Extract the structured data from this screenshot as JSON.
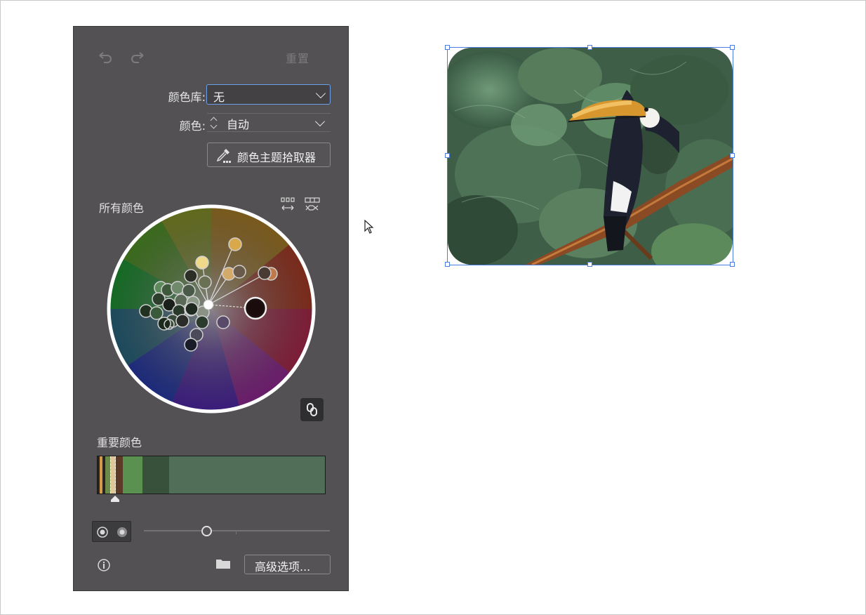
{
  "panel": {
    "undo_icon": "undo-icon",
    "redo_icon": "redo-icon",
    "reset_label": "重置",
    "library_label": "颜色库:",
    "library_value": "无",
    "color_label": "颜色:",
    "color_value": "自动",
    "theme_picker_label": "颜色主题拾取器",
    "all_colors_label": "所有颜色",
    "important_colors_label": "重要颜色",
    "advanced_label": "高级选项...",
    "swatch_colors": [
      "#2a231f",
      "#d39a47",
      "#6b8a4a",
      "#e0c79a",
      "#5b3a28",
      "#5b9150",
      "#37513a",
      "#516e58"
    ]
  },
  "canvas": {
    "image_subject": "toucan-on-branch",
    "selection_color": "#4a7ce0"
  }
}
